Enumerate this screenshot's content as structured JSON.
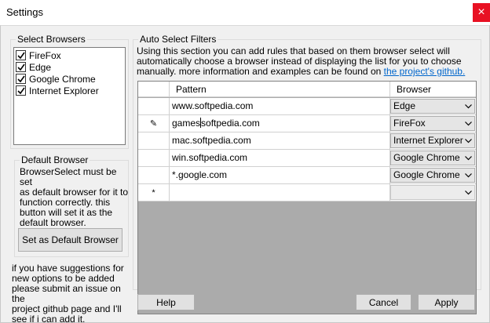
{
  "window": {
    "title": "Settings",
    "close_glyph": "×"
  },
  "select_browsers": {
    "legend": "Select Browsers",
    "items": [
      {
        "label": "FireFox",
        "checked": true
      },
      {
        "label": "Edge",
        "checked": true
      },
      {
        "label": "Google Chrome",
        "checked": true
      },
      {
        "label": "Internet Explorer",
        "checked": true
      }
    ]
  },
  "default_browser": {
    "legend": "Default Browser",
    "lines": [
      "BrowserSelect must be set",
      "as default browser for it to",
      "function correctly. this",
      "button will set it as the",
      "default browser."
    ],
    "button_label": "Set as Default Browser"
  },
  "suggestions": {
    "lines": [
      "if you have suggestions for",
      "new options to be added",
      "please submit an issue on the",
      "project github page and I'll",
      "see if i can add it."
    ]
  },
  "auto_select": {
    "legend": "Auto Select Filters",
    "intro_lines": [
      "Using this section you can add rules that based on them browser select will",
      "automatically choose a browser instead of displaying the list for you to choose"
    ],
    "intro_line3_prefix": "manually. more information and examples can be found on ",
    "link_text": "the project's github.",
    "columns": {
      "pattern": "Pattern",
      "browser": "Browser"
    },
    "rows": [
      {
        "pattern": "www.softpedia.com",
        "browser": "Edge"
      },
      {
        "pattern_before_caret": "games",
        "pattern_after_caret": "softpedia.com",
        "browser": "FireFox",
        "editing": true
      },
      {
        "pattern": "mac.softpedia.com",
        "browser": "Internet Explorer"
      },
      {
        "pattern": "win.softpedia.com",
        "browser": "Google Chrome"
      },
      {
        "pattern": "*.google.com",
        "browser": "Google Chrome"
      },
      {
        "pattern": "",
        "browser": "",
        "new_row": true
      }
    ],
    "edit_marker": "✎",
    "new_row_marker": "*"
  },
  "buttons": {
    "help": "Help",
    "cancel": "Cancel",
    "apply": "Apply"
  },
  "colors": {
    "close": "#e81123",
    "link": "#0066cc",
    "grid_empty": "#ababab",
    "accent": "#0078d7"
  },
  "icons": {
    "check": "check-icon",
    "dropdown": "chevron-down-icon",
    "pencil": "pencil-icon"
  }
}
